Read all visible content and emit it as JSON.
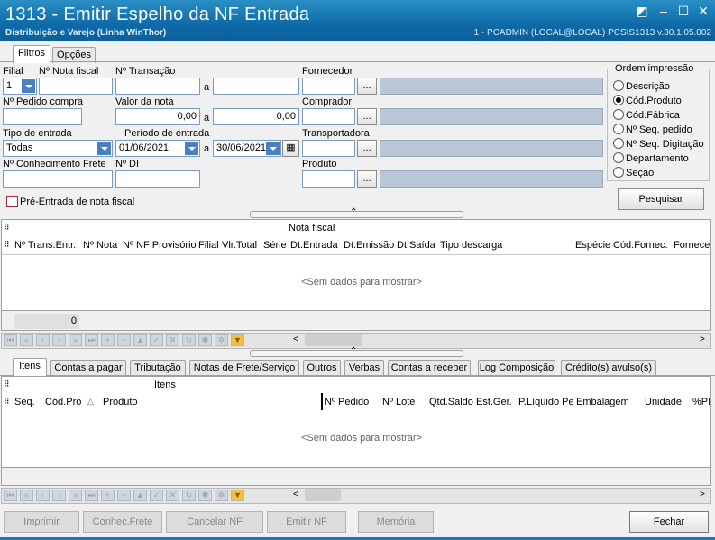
{
  "window": {
    "title": "1313 - Emitir Espelho da NF Entrada",
    "subtitle": "Distribuição e Varejo (Linha WinThor)",
    "status": "1 - PCADMIN (LOCAL@LOCAL)   PCSIS1313  v.30.1.05.002"
  },
  "top_tabs": [
    "Filtros",
    "Opções"
  ],
  "filters": {
    "filial_label": "Filial",
    "filial_value": "1",
    "nota_fiscal_label": "Nº Nota fiscal",
    "transacao_label": "Nº Transação",
    "a": "a",
    "fornecedor_label": "Fornecedor",
    "pedido_compra_label": "Nº Pedido compra",
    "valor_nota_label": "Valor da nota",
    "valor_from": "0,00",
    "valor_to": "0,00",
    "comprador_label": "Comprador",
    "tipo_entrada_label": "Tipo de entrada",
    "tipo_entrada_value": "Todas",
    "periodo_label": "Período de entrada",
    "periodo_from": "01/06/2021",
    "periodo_to": "30/06/2021",
    "transportadora_label": "Transportadora",
    "conhecimento_label": "Nº Conhecimento Frete",
    "di_label": "Nº DI",
    "produto_label": "Produto",
    "pre_entrada_label": "Pré-Entrada de nota fiscal",
    "ellipsis": "..."
  },
  "ordem": {
    "title": "Ordem impressão",
    "options": [
      "Descrição",
      "Cód.Produto",
      "Cód.Fábrica",
      "Nº Seq. pedido",
      "Nº Seq. Digitação",
      "Departamento",
      "Seção"
    ],
    "selected_index": 1
  },
  "pesquisar_label": "Pesquisar",
  "grid1": {
    "group": "Nota fiscal",
    "columns": [
      "Nº Trans.Entr.",
      "Nº Nota",
      "Nº NF Provisório",
      "Filial",
      "Vlr.Total",
      "Série",
      "Dt.Entrada",
      "Dt.Emissão",
      "Dt.Saída",
      "Tipo descarga",
      "Espécie",
      "Cód.Fornec.",
      "Fornece"
    ],
    "empty": "<Sem dados para mostrar>",
    "footer_value": "0"
  },
  "bottom_tabs": [
    "Itens",
    "Contas a pagar",
    "Tributação",
    "Notas de Frete/Serviço",
    "Outros",
    "Verbas",
    "Contas a receber",
    "Log Composição",
    "Crédito(s) avulso(s)"
  ],
  "grid2": {
    "group": "Itens",
    "columns": [
      "Seq.",
      "Cód.Pro",
      "Produto",
      "Nº Pedido",
      "Nº Lote",
      "Qtd.Saldo Est.Ger.",
      "P.Líquido Pe",
      "Embalagem",
      "Unidade",
      "%PI"
    ],
    "sort_indicator": "△",
    "empty": "<Sem dados para mostrar>"
  },
  "actions": {
    "imprimir": "Imprimir",
    "conhec_frete": "Conhec.Frete",
    "cancelar_nf": "Cancelar NF",
    "emitir_nf": "Emitir NF",
    "memoria": "Memória",
    "fechar": "Fechar"
  },
  "colors": {
    "title_bg": "#1a7ab8",
    "field_gray": "#b8c6d8",
    "button_disabled": "#dcdcdc"
  }
}
